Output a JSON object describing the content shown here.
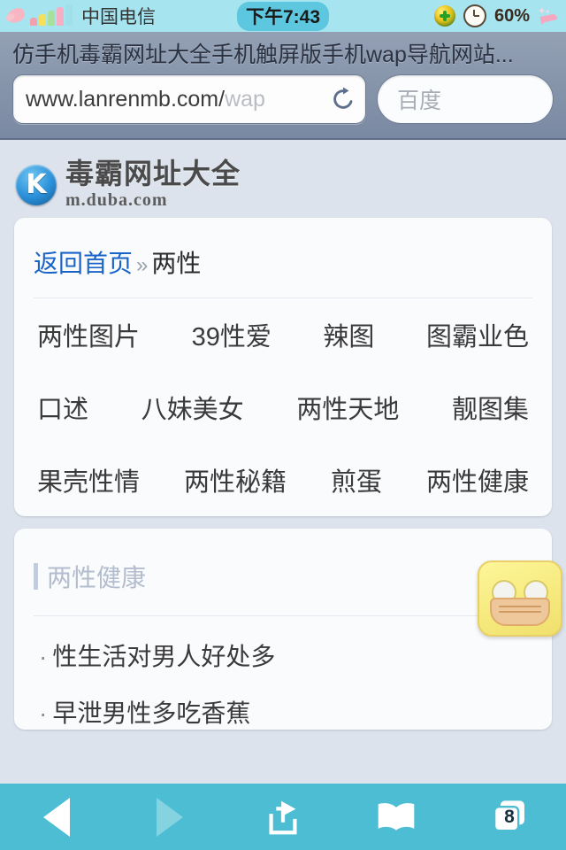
{
  "statusbar": {
    "carrier": "中国电信",
    "time": "下午7:43",
    "battery": "60%",
    "icons": [
      "hand-icon",
      "signal-bars-icon",
      "security-shield-icon",
      "alarm-clock-icon",
      "high-heel-icon"
    ]
  },
  "chrome": {
    "page_title": "仿手机毒霸网址大全手机触屏版手机wap导航网站...",
    "url_main": "www.lanrenmb.com/",
    "url_dim": "wap",
    "reload_icon": "reload-icon",
    "search_placeholder": "百度"
  },
  "site": {
    "logo_letter": "K",
    "logo_title": "毒霸网址大全",
    "logo_domain": "m.duba.com"
  },
  "breadcrumb": {
    "home": "返回首页",
    "separator": "»",
    "current": "两性"
  },
  "links": {
    "row1": [
      "两性图片",
      "39性爱",
      "辣图",
      "图霸业色"
    ],
    "row2": [
      "口述",
      "八妹美女",
      "两性天地",
      "靓图集"
    ],
    "row3": [
      "果壳性情",
      "两性秘籍",
      "煎蛋",
      "两性健康"
    ]
  },
  "section": {
    "title": "两性健康",
    "articles": [
      "性生活对男人好处多",
      "早泄男性多吃香蕉"
    ],
    "bullet": "·"
  },
  "assistant": {
    "name": "floating-face-button"
  },
  "toolbar": {
    "back": "back-icon",
    "forward": "forward-icon",
    "share": "share-icon",
    "bookmarks": "bookmarks-icon",
    "tabs": "tabs-icon",
    "tab_count": "8"
  },
  "colors": {
    "statusbar_bg": "#a6e4ef",
    "time_highlight": "#5cc7de",
    "chrome_bg": "#8795ab",
    "page_bg": "#dde3ec",
    "card_bg": "#fafbfd",
    "link_blue": "#1a64c8",
    "toolbar_bg": "#4cbdd2",
    "section_title": "#b3bdcd"
  }
}
